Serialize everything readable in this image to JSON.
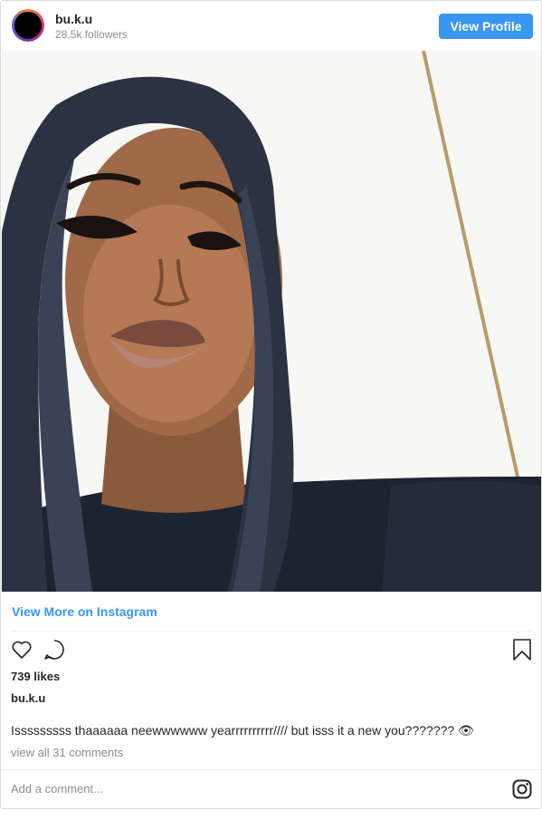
{
  "header": {
    "username": "bu.k.u",
    "followers": "28.5k followers",
    "view_profile_label": "View Profile"
  },
  "post": {
    "view_more_label": "View More on Instagram",
    "likes": "739 likes",
    "caption_username": "bu.k.u",
    "caption_text": "Isssssssss thaaaaaa neewwwwww yearrrrrrrrrr//// but isss it a new you??????? 👁",
    "view_comments": "view all 31 comments",
    "add_comment_placeholder": "Add a comment...",
    "image_description_icons": [
      "heart-icon",
      "comment-icon",
      "bookmark-icon",
      "instagram-logo-icon"
    ]
  },
  "colors": {
    "accent": "#3897f0",
    "muted_text": "#8e8e8e",
    "text": "#262626",
    "border": "#dbdbdb"
  }
}
